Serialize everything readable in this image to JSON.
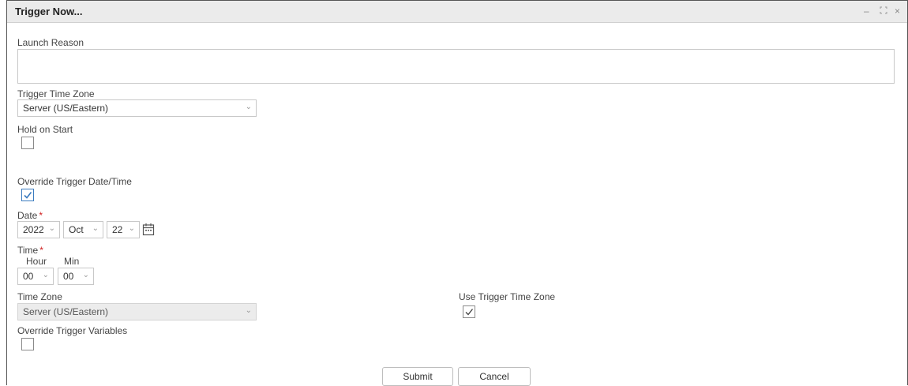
{
  "window": {
    "title": "Trigger Now...",
    "controls": {
      "minimize": "–",
      "maximize": "⛶",
      "close": "×"
    }
  },
  "form": {
    "launch_reason": {
      "label": "Launch Reason",
      "value": ""
    },
    "trigger_time_zone": {
      "label": "Trigger Time Zone",
      "value": "Server (US/Eastern)"
    },
    "hold_on_start": {
      "label": "Hold on Start",
      "checked": false
    },
    "override_datetime": {
      "label": "Override Trigger Date/Time",
      "checked": true
    },
    "date": {
      "label": "Date",
      "required_mark": "*",
      "year": "2022",
      "month": "Oct",
      "day": "22",
      "calendar_icon": "calendar-icon"
    },
    "time": {
      "label": "Time",
      "required_mark": "*",
      "hour_label": "Hour",
      "min_label": "Min",
      "hour": "00",
      "min": "00"
    },
    "time_zone": {
      "label": "Time Zone",
      "value": "Server (US/Eastern)",
      "disabled": true
    },
    "use_trigger_time_zone": {
      "label": "Use Trigger Time Zone",
      "checked": true
    },
    "override_variables": {
      "label": "Override Trigger Variables",
      "checked": false
    }
  },
  "buttons": {
    "submit": "Submit",
    "cancel": "Cancel"
  },
  "icons": {
    "chevron": "⌄",
    "check": "check-icon"
  },
  "colors": {
    "titlebar": "#ebebeb",
    "required": "#d02020",
    "checkbox_checked_border": "#3b7bbf"
  }
}
